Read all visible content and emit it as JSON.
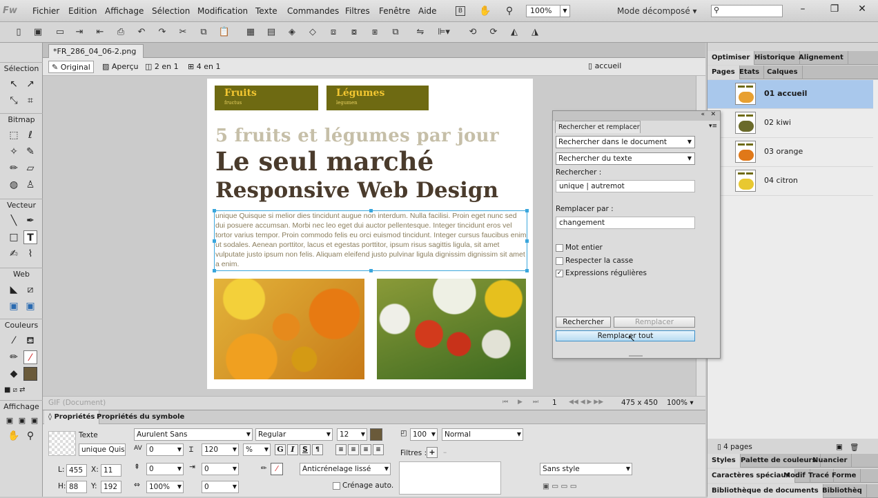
{
  "app": {
    "logo": "Fw",
    "workspace": "Mode décomposé",
    "zoom": "100%"
  },
  "menu": [
    "Fichier",
    "Edition",
    "Affichage",
    "Sélection",
    "Modification",
    "Texte",
    "Commandes",
    "Filtres",
    "Fenêtre",
    "Aide"
  ],
  "document": {
    "tab": "*FR_286_04_06-2.png",
    "views": [
      "Original",
      "Aperçu",
      "2 en 1",
      "4 en 1"
    ],
    "page_select": "accueil"
  },
  "tools": {
    "sections": [
      "Sélection",
      "Bitmap",
      "Vecteur",
      "Web",
      "Couleurs",
      "Affichage"
    ]
  },
  "artboard": {
    "nav1": {
      "title": "Fruits",
      "sub": "fructus"
    },
    "nav2": {
      "title": "Légumes",
      "sub": "legumen"
    },
    "subtitle": "5 fruits et légumes par jour",
    "title1": "Le seul marché",
    "title2": "Responsive Web Design",
    "body": "unique Quisque si melior dies tincidunt augue non interdum. Nulla facilisi. Proin eget nunc sed dui posuere accumsan. Morbi nec leo eget dui auctor pellentesque. Integer tincidunt eros vel tortor varius tempor. Proin commodo felis eu orci euismod tincidunt. Integer cursus faucibus enim ut sodales. Aenean porttitor, lacus et egestas porttitor, ipsum risus sagittis ligula, sit amet vulputate justo ipsum non felis. Aliquam eleifend justo pulvinar ligula dignissim dignissim sit amet a enim."
  },
  "status": {
    "format": "GIF (Document)",
    "page": "1",
    "size": "475 x 450",
    "zoom": "100%"
  },
  "properties": {
    "tabs": [
      "Propriétés",
      "Propriétés du symbole"
    ],
    "type_label": "Texte",
    "name": "unique Quisc",
    "font": "Aurulent Sans",
    "style": "Regular",
    "size": "12",
    "kerning": "0",
    "leading": "120",
    "leading_unit": "%",
    "baseline": "0",
    "indent": "0",
    "space_after": "0",
    "horiz_scale": "100%",
    "opacity": "100",
    "blend": "Normal",
    "filters_label": "Filtres :",
    "antialias": "Anticrénelage lissé",
    "autokern": "Crénage auto.",
    "text_style": "Sans style",
    "L": "455",
    "X": "11",
    "H": "88",
    "Y": "192",
    "text_color": "#6a5a3a"
  },
  "find_dialog": {
    "title": "Rechercher et remplacer",
    "scope": "Rechercher dans le document",
    "find_type": "Rechercher du texte",
    "find_label": "Rechercher :",
    "find_value": "unique | autremot",
    "replace_label": "Remplacer par :",
    "replace_value": "changement",
    "options": [
      {
        "label": "Mot entier",
        "checked": false
      },
      {
        "label": "Respecter la casse",
        "checked": false
      },
      {
        "label": "Expressions régulières",
        "checked": true
      }
    ],
    "btn_find": "Rechercher",
    "btn_replace": "Remplacer",
    "btn_replace_all": "Remplacer tout"
  },
  "right_panel": {
    "tabs_top": [
      "Optimiser",
      "Historique",
      "Alignement"
    ],
    "tabs_pages": [
      "Pages",
      "Etats",
      "Calques"
    ],
    "pages": [
      {
        "name": "01 accueil",
        "selected": true,
        "thumb": "#e8a030"
      },
      {
        "name": "02 kiwi",
        "selected": false,
        "thumb": "#6a6a2a"
      },
      {
        "name": "03 orange",
        "selected": false,
        "thumb": "#e07818"
      },
      {
        "name": "04 citron",
        "selected": false,
        "thumb": "#e8c830"
      }
    ],
    "page_count": "4 pages",
    "tabs_bottom1": [
      "Styles",
      "Palette de couleurs",
      "Nuancier"
    ],
    "tabs_bottom2": [
      "Caractères spéciaux",
      "Modif",
      "Tracé",
      "Forme"
    ],
    "tabs_bottom3": [
      "Bibliothèque de documents",
      "Bibliothèq"
    ]
  }
}
